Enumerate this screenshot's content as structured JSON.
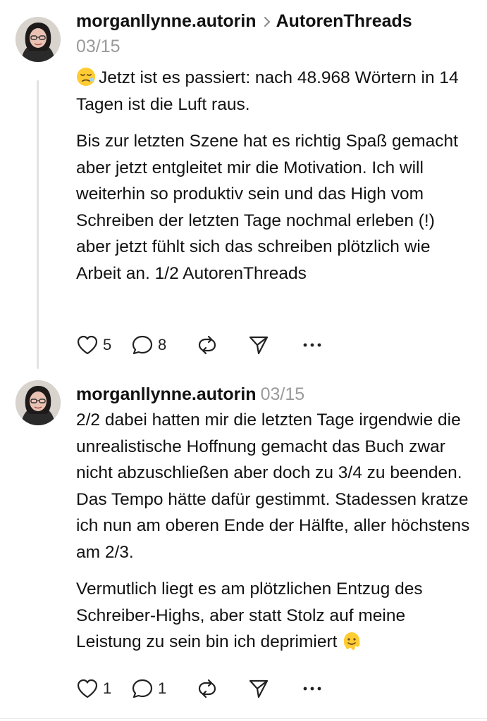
{
  "posts": [
    {
      "username": "morganllynne.autorin",
      "community": "AutorenThreads",
      "date": "03/15",
      "emoji_icon": "tired-face-emoji",
      "paragraphs": [
        "Jetzt ist es passiert: nach 48.968 Wörtern in 14 Tagen ist die Luft raus.",
        "Bis zur letzten Szene hat es richtig Spaß gemacht aber jetzt entgleitet mir die Motivation. Ich will weiterhin so produktiv sein und das High vom Schreiben der letzten Tage nochmal erleben (!) aber jetzt fühlt sich das schreiben plötzlich wie Arbeit an. 1/2 AutorenThreads"
      ],
      "likes": "5",
      "replies": "8"
    },
    {
      "username": "morganllynne.autorin",
      "date": "03/15",
      "emoji_icon": "melting-face-emoji",
      "paragraphs": [
        "2/2 dabei hatten mir die letzten Tage irgendwie die unrealistische Hoffnung gemacht das Buch zwar nicht abzuschließen aber doch zu 3/4 zu beenden. Das Tempo hätte dafür gestimmt. Stadessen kratze ich nun am oberen Ende der Hälfte, aller höchstens am 2/3.",
        "Vermutlich liegt es am plötzlichen Entzug des Schreiber-Highs, aber statt Stolz auf meine Leistung zu sein bin ich deprimiert"
      ],
      "likes": "1",
      "replies": "1"
    }
  ],
  "icons": {
    "like": "heart-icon",
    "reply": "comment-icon",
    "repost": "repost-icon",
    "share": "send-icon",
    "more": "more-icon",
    "separator": "chevron-right-icon"
  },
  "colors": {
    "text": "#111111",
    "muted": "#9a9a9a",
    "thread_line": "#e3e3e3"
  }
}
